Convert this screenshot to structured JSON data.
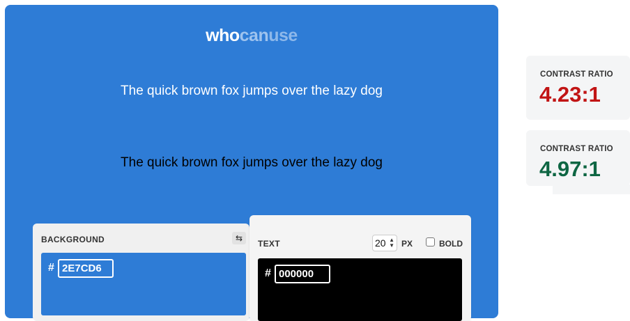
{
  "logo": {
    "part1": "who",
    "part2": "can",
    "part3": "use"
  },
  "samples": {
    "white_text": "The quick brown fox jumps over the lazy dog",
    "black_text": "The quick brown fox jumps over the lazy dog"
  },
  "background_card": {
    "label": "BACKGROUND",
    "hash": "#",
    "hex_value": "2E7CD6",
    "swap_icon": "swap-arrows-icon"
  },
  "text_card": {
    "label": "TEXT",
    "hash": "#",
    "hex_value": "000000",
    "size_value": "20",
    "size_unit": "PX",
    "bold_label": "BOLD",
    "bold_checked": false
  },
  "ratios": [
    {
      "label": "CONTRAST RATIO",
      "value": "4.23:1",
      "color": "#C11414"
    },
    {
      "label": "CONTRAST RATIO",
      "value": "4.97:1",
      "color": "#0E6643"
    }
  ],
  "colors": {
    "background": "#2E7CD6",
    "text": "#000000"
  }
}
